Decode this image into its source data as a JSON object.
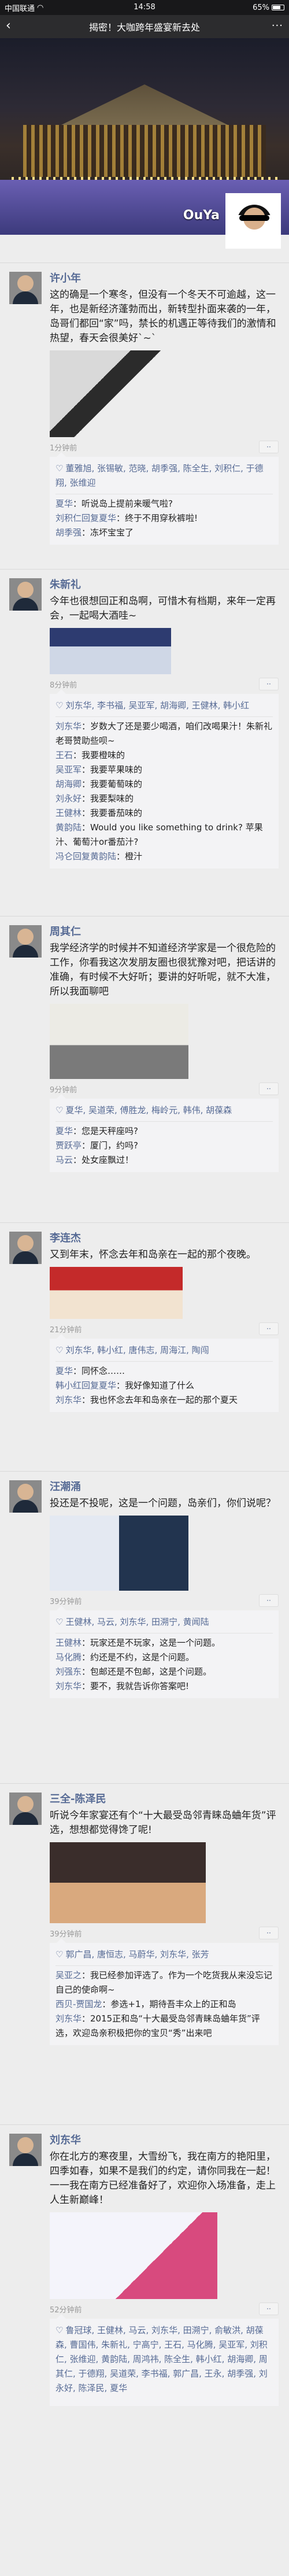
{
  "status_bar": {
    "carrier": "中国联通",
    "wifi": "WiFi",
    "time": "14:58",
    "battery": "65%"
  },
  "nav": {
    "title": "揭密！大咖跨年盛宴新去处",
    "back": "‹",
    "more": "···"
  },
  "cover": {
    "name": "OuYa"
  },
  "posts": [
    {
      "name": "许小年",
      "text": "这的确是一个寒冬，但没有一个冬天不可逾越，这一年，也是新经济蓬勃而出，新转型扑面来袭的一年，岛哥们都回“家”吗，禁长的机遇正等待我们的激情和热望，春天会很美好`~`",
      "time": "1分钟前",
      "likes": "董雅旭, 张锡敏, 范晓, 胡季强, 陈全生, 刘积仁, 于德翔, 张维迎",
      "comments": [
        {
          "user": "夏华",
          "text": "：听说岛上提前来暖气啦?"
        },
        {
          "user": "刘积仁回复夏华",
          "text": "：终于不用穿秋裤啦!"
        },
        {
          "user": "胡季强",
          "text": "：冻坏宝宝了"
        }
      ]
    },
    {
      "name": "朱新礼",
      "text": "今年也很想回正和岛啊，可惜木有档期，来年一定再会，一起喝大酒哇~",
      "time": "8分钟前",
      "likes": "刘东华, 李书福, 吴亚军, 胡海卿, 王健林, 韩小红",
      "comments": [
        {
          "user": "刘东华",
          "text": "：岁数大了还是要少喝酒，咱们改喝果汁！朱新礼老哥赞助些呗~"
        },
        {
          "user": "王石",
          "text": "：我要橙味的"
        },
        {
          "user": "吴亚军",
          "text": "：我要苹果味的"
        },
        {
          "user": "胡海卿",
          "text": "：我要葡萄味的"
        },
        {
          "user": "刘永好",
          "text": "：我要梨味的"
        },
        {
          "user": "王健林",
          "text": "：我要番茄味的"
        },
        {
          "user": "黄韵陆",
          "text": "：Would you like something to drink? 苹果汁、葡萄汁or番茄汁?"
        },
        {
          "user": "冯仑回复黄韵陆",
          "text": "：橙汁"
        }
      ]
    },
    {
      "name": "周其仁",
      "text": "我学经济学的时候并不知道经济学家是一个很危险的工作，你看我这次发朋友圈也很犹豫对吧，把话讲的准确，有时候不大好听；要讲的好听呢，就不大准，所以我面聊吧",
      "time": "9分钟前",
      "likes": "夏华, 吴道荣, 傅胜龙, 梅岭元, 韩伟, 胡葆森",
      "comments": [
        {
          "user": "夏华",
          "text": "：您是天秤座吗?"
        },
        {
          "user": "贾跃亭",
          "text": "：厦门，约吗?"
        },
        {
          "user": "马云",
          "text": "：处女座飘过！"
        }
      ]
    },
    {
      "name": "李连杰",
      "text": "又到年末，怀念去年和岛亲在一起的那个夜晚。",
      "time": "21分钟前",
      "likes": "刘东华, 韩小红, 唐伟志, 周海江, 陶闯",
      "comments": [
        {
          "user": "夏华",
          "text": "：同怀念……"
        },
        {
          "user": "韩小红回复夏华",
          "text": "：我好像知道了什么"
        },
        {
          "user": "刘东华",
          "text": "：我也怀念去年和岛亲在一起的那个夏天"
        }
      ]
    },
    {
      "name": "汪潮涌",
      "text": "投还是不投呢，这是一个问题，岛亲们，你们说呢？",
      "time": "39分钟前",
      "likes": "王健林, 马云, 刘东华, 田溯宁, 黄闻陆",
      "comments": [
        {
          "user": "王健林",
          "text": "：玩家还是不玩家，这是一个问题。"
        },
        {
          "user": "马化腾",
          "text": "：约还是不约，这是个问题。"
        },
        {
          "user": "刘强东",
          "text": "：包邮还是不包邮，这是个问题。"
        },
        {
          "user": "刘东华",
          "text": "：要不，我就告诉你答案吧!"
        }
      ]
    },
    {
      "name": "三全-陈泽民",
      "text": "听说今年家宴还有个“十大最受岛邻青睐岛蛐年货”评选，想想都觉得馋了呢!",
      "time": "39分钟前",
      "likes": "郭广昌, 唐恒志, 马蔚华, 刘东华, 张芳",
      "comments": [
        {
          "user": "吴亚之",
          "text": "：我已经参加评选了。作为一个吃货我从来没忘记自己的使命啊~"
        },
        {
          "user": "西贝-贾国龙",
          "text": "：参选+1，期待吾丰众上的正和岛"
        },
        {
          "user": "刘东华",
          "text": "：2015正和岛“十大最受岛邻青睐岛蛐年货”评选，欢迎岛亲积极把你的宝贝“秀”出来吧"
        }
      ]
    },
    {
      "name": "刘东华",
      "text": "你在北方的寒夜里，大雪纷飞，我在南方的艳阳里，四季如春，如果不是我们的约定，请你同我在一起！一一我在南方已经准备好了，欢迎你入场准备，走上人生新巅峰！",
      "time": "52分钟前",
      "likes": "鲁冠球, 王健林, 马云, 刘东华, 田溯宁, 俞敏洪, 胡葆森, 曹国伟, 朱新礼, 宁高宁, 王石, 马化腾, 吴亚军, 刘积仁, 张维迎, 黄韵陆, 周鸿祎, 陈全生, 韩小红, 胡海卿, 周其仁, 于德翔, 吴道荣, 李书福, 郭广昌, 王永, 胡季强, 刘永好, 陈泽民, 夏华",
      "comments": []
    }
  ]
}
